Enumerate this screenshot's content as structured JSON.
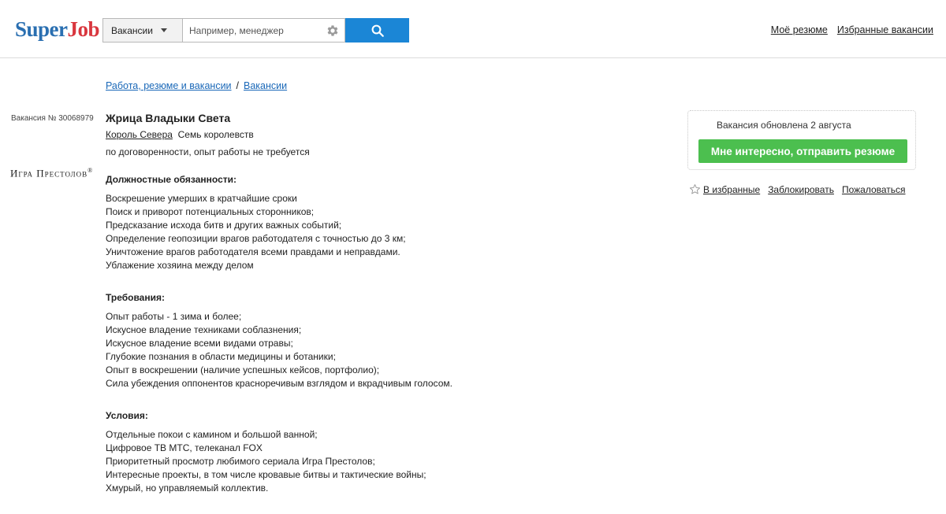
{
  "header": {
    "logo_part1": "Super",
    "logo_part2": "Job",
    "category_select": "Вакансии",
    "search_placeholder": "Например, менеджер",
    "links": [
      "Моё резюме",
      "Избранные вакансии"
    ]
  },
  "breadcrumb": {
    "items": [
      "Работа, резюме и вакансии",
      "Вакансии"
    ],
    "separator": "/"
  },
  "vacancy": {
    "number": "Вакансия № 30068979",
    "company_logo_text": "Игра Престолов",
    "company_logo_mark": "®",
    "title": "Жрица Владыки Света",
    "company": "Король Севера",
    "location": "Семь королевств",
    "salary": "по договоренности, опыт работы не требуется",
    "sections": [
      {
        "heading": "Должностные обязанности:",
        "items": [
          "Воскрешение умерших в кратчайшие сроки",
          "Поиск и приворот потенциальных сторонников;",
          "Предсказание исхода битв и других важных событий;",
          "Определение геопозиции врагов работодателя с точностью до 3 км;",
          "Уничтожение врагов работодателя всеми правдами и неправдами.",
          "Ублажение хозяина между делом"
        ]
      },
      {
        "heading": "Требования:",
        "items": [
          "Опыт работы - 1 зима и более;",
          "Искусное владение техниками соблазнения;",
          "Искусное владение всеми видами отравы;",
          "Глубокие познания в области медицины и ботаники;",
          "Опыт в воскрешении (наличие успешных кейсов, портфолио);",
          "Сила убеждения оппонентов красноречивым взглядом и вкрадчивым голосом."
        ]
      },
      {
        "heading": "Условия:",
        "items": [
          "Отдельные покои с камином и большой ванной;",
          "Цифровое ТВ МТС, телеканал FOX",
          "Приоритетный просмотр любимого сериала Игра Престолов;",
          "Интересные проекты, в том числе кровавые битвы и тактические войны;",
          "Хмурый, но управляемый коллектив."
        ]
      }
    ]
  },
  "sidebar": {
    "updated": "Вакансия обновлена 2 августа",
    "apply_button": "Мне интересно, отправить резюме",
    "actions": [
      "В избранные",
      "Заблокировать",
      "Пожаловаться"
    ]
  },
  "colors": {
    "logo_blue": "#2a6fb1",
    "logo_red": "#d9363e",
    "search_button": "#1b86d6",
    "apply_button": "#4cbf4f",
    "link_blue": "#1a68b8"
  }
}
